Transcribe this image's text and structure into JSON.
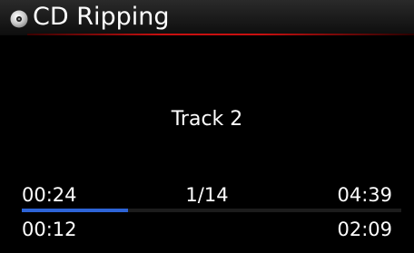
{
  "header": {
    "title": "CD Ripping",
    "icon": "cd-icon",
    "accent_color": "#c81010"
  },
  "track": {
    "name": "Track 2",
    "elapsed": "00:24",
    "position": "1/14",
    "total": "04:39"
  },
  "ripping": {
    "elapsed": "00:12",
    "remaining": "02:09",
    "progress_fraction": 0.28,
    "progress_color": "#2d63d6"
  }
}
